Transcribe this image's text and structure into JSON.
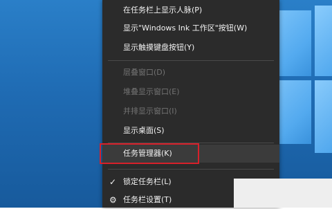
{
  "menu": {
    "items": [
      {
        "label": "在任务栏上显示人脉(P)",
        "enabled": true
      },
      {
        "label": "显示\"Windows Ink 工作区\"按钮(W)",
        "enabled": true
      },
      {
        "label": "显示触摸键盘按钮(Y)",
        "enabled": true
      },
      {
        "label": "层叠窗口(D)",
        "enabled": false
      },
      {
        "label": "堆叠显示窗口(E)",
        "enabled": false
      },
      {
        "label": "并排显示窗口(I)",
        "enabled": false
      },
      {
        "label": "显示桌面(S)",
        "enabled": true
      },
      {
        "label": "任务管理器(K)",
        "enabled": true,
        "highlighted": true
      },
      {
        "label": "锁定任务栏(L)",
        "enabled": true,
        "checked": true
      },
      {
        "label": "任务栏设置(T)",
        "enabled": true
      }
    ]
  },
  "colors": {
    "menu_bg": "#2b2b2b",
    "menu_text": "#f2f2f2",
    "disabled_text": "#737373",
    "highlight_border": "#d8202a",
    "desktop_blue": "#1f6bb3"
  },
  "icons": {
    "checked": "checkmark-icon",
    "settings": "gear-icon"
  }
}
